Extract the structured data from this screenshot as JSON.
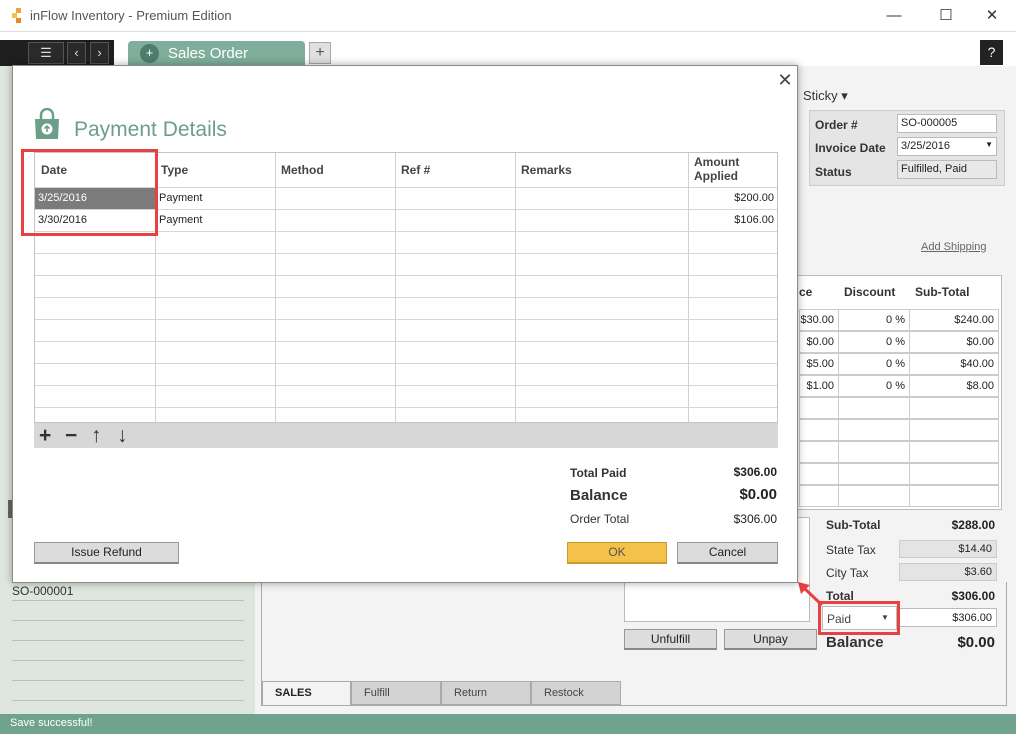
{
  "window": {
    "title": "inFlow Inventory - Premium Edition",
    "minimize": "—",
    "maximize": "☐",
    "close": "✕"
  },
  "nav": {
    "menu": "☰",
    "back": "‹",
    "forward": "›",
    "tab_label": "Sales Order",
    "add_tab": "+",
    "help": "?"
  },
  "order_header": {
    "sticky": "Sticky",
    "order_num_label": "Order #",
    "order_num": "SO-000005",
    "invoice_date_label": "Invoice Date",
    "invoice_date": "3/25/2016",
    "status_label": "Status",
    "status": "Fulfilled, Paid",
    "add_shipping": "Add Shipping"
  },
  "line_items": {
    "headers": [
      "ce",
      "Discount",
      "Sub-Total"
    ],
    "rows": [
      {
        "price": "$30.00",
        "discount": "0 %",
        "subtotal": "$240.00"
      },
      {
        "price": "$0.00",
        "discount": "0 %",
        "subtotal": "$0.00"
      },
      {
        "price": "$5.00",
        "discount": "0 %",
        "subtotal": "$40.00"
      },
      {
        "price": "$1.00",
        "discount": "0 %",
        "subtotal": "$8.00"
      }
    ]
  },
  "order_totals": {
    "subtotal_label": "Sub-Total",
    "subtotal": "$288.00",
    "state_tax_label": "State Tax",
    "state_tax": "$14.40",
    "city_tax_label": "City Tax",
    "city_tax": "$3.60",
    "total_label": "Total",
    "total": "$306.00",
    "paid_label": "Paid",
    "paid": "$306.00",
    "balance_label": "Balance",
    "balance": "$0.00",
    "unfulfill": "Unfulfill",
    "unpay": "Unpay"
  },
  "left_list": {
    "item": "SO-000001"
  },
  "bottom_tabs": [
    "SALES",
    "Fulfill",
    "Return",
    "Restock"
  ],
  "status_bar": "Save successful!",
  "dialog": {
    "title": "Payment Details",
    "close": "✕",
    "columns": [
      "Date",
      "Type",
      "Method",
      "Ref #",
      "Remarks",
      "Amount Applied"
    ],
    "amount_col_line1": "Amount",
    "amount_col_line2": "Applied",
    "payments": [
      {
        "date": "3/25/2016",
        "type": "Payment",
        "method": "",
        "ref": "",
        "remarks": "",
        "amount": "$200.00"
      },
      {
        "date": "3/30/2016",
        "type": "Payment",
        "method": "",
        "ref": "",
        "remarks": "",
        "amount": "$106.00"
      }
    ],
    "tools": {
      "add": "+",
      "remove": "−",
      "up": "↑",
      "down": "↓"
    },
    "total_paid_label": "Total Paid",
    "total_paid": "$306.00",
    "balance_label": "Balance",
    "balance": "$0.00",
    "order_total_label": "Order Total",
    "order_total": "$306.00",
    "issue_refund": "Issue Refund",
    "ok": "OK",
    "cancel": "Cancel"
  },
  "colors": {
    "accent_green": "#6fa38d",
    "highlight_red": "#e84141",
    "ok_button": "#f4c14a"
  }
}
